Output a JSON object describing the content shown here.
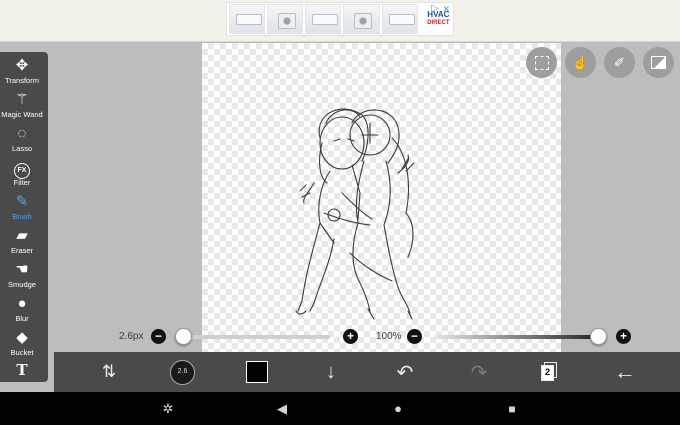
{
  "ad": {
    "brand_line1": "HVAC",
    "brand_line2": "DIRECT",
    "choices_icon": "adchoices-icon",
    "close_icon": "close-icon"
  },
  "toolbox": {
    "items": [
      {
        "label": "Transform",
        "icon": "move-arrows-icon"
      },
      {
        "label": "Magic Wand",
        "icon": "magic-wand-icon"
      },
      {
        "label": "Lasso",
        "icon": "lasso-icon"
      },
      {
        "label": "Filter",
        "icon": "fx-icon",
        "glyph": "FX"
      },
      {
        "label": "Brush",
        "icon": "brush-icon",
        "active": true
      },
      {
        "label": "Eraser",
        "icon": "eraser-icon"
      },
      {
        "label": "Smudge",
        "icon": "smudge-icon"
      },
      {
        "label": "Blur",
        "icon": "blur-drop-icon"
      },
      {
        "label": "Bucket",
        "icon": "bucket-icon"
      },
      {
        "label": "",
        "icon": "text-tool-icon",
        "glyph": "T"
      }
    ],
    "active_color": "#4aa3ff"
  },
  "top_buttons": [
    "selection-icon",
    "touch-gesture-icon",
    "ruler-pen-icon",
    "image-icon"
  ],
  "brush_settings": {
    "size_label": "2.6px",
    "size_level": 0.02,
    "opacity_label": "100%",
    "opacity_level": 1.0,
    "minus_glyph": "−",
    "plus_glyph": "+"
  },
  "bottom_toolbar": {
    "icons": [
      "flip-swap-icon",
      "brush-preview-icon",
      "color-swatch",
      "download-arrow-icon",
      "undo-icon",
      "redo-icon",
      "layers-icon",
      "back-arrow-icon"
    ],
    "brush_preview_text": "2.6",
    "current_color": "#000000",
    "layer_count": "2"
  },
  "system_nav": [
    "screenshot-sparkle-icon",
    "back-triangle-icon",
    "home-circle-icon",
    "recents-square-icon"
  ]
}
